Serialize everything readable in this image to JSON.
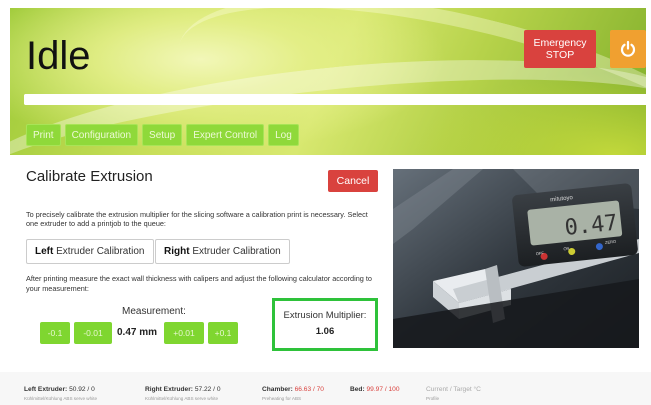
{
  "header": {
    "status": "Idle",
    "emergency_line1": "Emergency",
    "emergency_line2": "STOP",
    "progress_fraction": 1.0
  },
  "nav": {
    "items": [
      "Print",
      "Configuration",
      "Setup",
      "Expert Control",
      "Log"
    ]
  },
  "calibration": {
    "title": "Calibrate Extrusion",
    "cancel_label": "Cancel",
    "intro": "To precisely calibrate the extrusion multiplier for the slicing software a calibration print is necessary. Select one extruder to add a printjob to the queue:",
    "left_bold": "Left",
    "left_rest": " Extruder Calibration",
    "right_bold": "Right",
    "right_rest": " Extruder Calibration",
    "after_text": "After printing measure the exact wall thickness with calipers and adjust the following calculator according to your measurement:",
    "measurement_label": "Measurement:",
    "buttons": [
      "-0.1",
      "-0.01",
      "+0.01",
      "+0.1"
    ],
    "measurement_value": "0.47 mm",
    "multiplier_label": "Extrusion Multiplier:",
    "multiplier_value": "1.06"
  },
  "photo": {
    "caliper_reading": "0.47",
    "brand": "mitutoyo",
    "btn_off": "OFF",
    "btn_on": "ON",
    "btn_zero": "ZERO"
  },
  "footer": {
    "left_label": "Left Extruder:",
    "left_value": "50.92 / 0",
    "left_sub": "Kühlmittel/Kühlung ABS serve white",
    "right_label": "Right Extruder:",
    "right_value": "57.22 / 0",
    "right_sub": "Kühlmittel/Kühlung ABS serve white",
    "chamber_label": "Chamber:",
    "chamber_value": "66.63 / 70",
    "chamber_sub": "Preheating for ABS",
    "bed_label": "Bed:",
    "bed_value": "99.97 / 100",
    "legend": "Current / Target °C",
    "legend_sub": "Profile"
  },
  "colors": {
    "accent_green": "#7fd630",
    "danger_red": "#d9423e",
    "power_orange": "#f0a030",
    "highlight_green": "#2ec23a"
  },
  "icons": {
    "power": "power-icon"
  }
}
